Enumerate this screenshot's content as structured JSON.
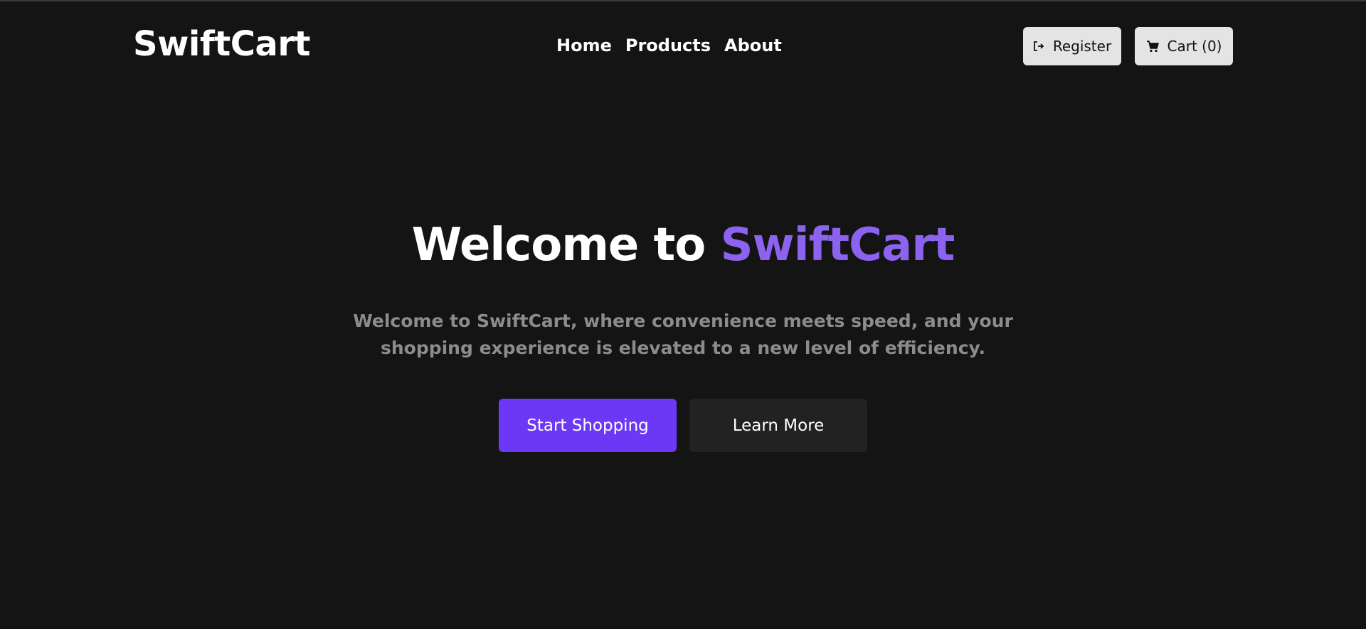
{
  "header": {
    "logo": "SwiftCart",
    "nav": [
      {
        "label": "Home"
      },
      {
        "label": "Products"
      },
      {
        "label": "About"
      }
    ],
    "register_label": "Register",
    "register_icon": "sign-in-icon",
    "cart_label": "Cart (0)",
    "cart_icon": "shopping-cart-icon"
  },
  "hero": {
    "title_prefix": "Welcome to ",
    "title_accent": "SwiftCart",
    "subtitle": "Welcome to SwiftCart, where convenience meets speed, and your shopping experience is elevated to a new level of efficiency.",
    "primary_cta": "Start Shopping",
    "secondary_cta": "Learn More"
  },
  "colors": {
    "background": "#141414",
    "accent": "#8b63ef",
    "primary_button": "#6d38f5",
    "secondary_button": "#222222",
    "header_button": "#e4e4e4",
    "subtitle_text": "#8c8c8c"
  }
}
